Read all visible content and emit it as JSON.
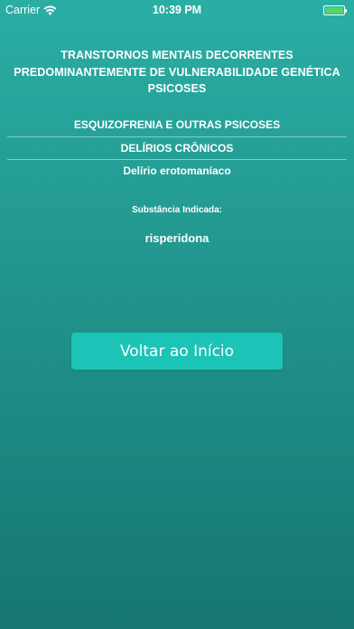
{
  "status_bar": {
    "carrier": "Carrier",
    "time": "10:39 PM",
    "battery_level": 1.0
  },
  "title_lines": [
    "TRANSTORNOS MENTAIS DECORRENTES",
    "PREDOMINANTEMENTE DE VULNERABILIDADE GENÉTICA",
    "PSICOSES"
  ],
  "path": [
    "ESQUIZOFRENIA E OUTRAS PSICOSES",
    "DELÍRIOS CRÔNICOS",
    "Delírio erotomaníaco"
  ],
  "substance": {
    "label": "Substância Indicada:",
    "value": "risperidona"
  },
  "back_button_label": "Voltar ao Início",
  "colors": {
    "background_top": "#2aaea4",
    "background_bottom": "#167671",
    "button": "#1cc3b7",
    "battery": "#4cd964"
  },
  "icons": {
    "wifi": "wifi-icon",
    "battery": "battery-icon"
  }
}
